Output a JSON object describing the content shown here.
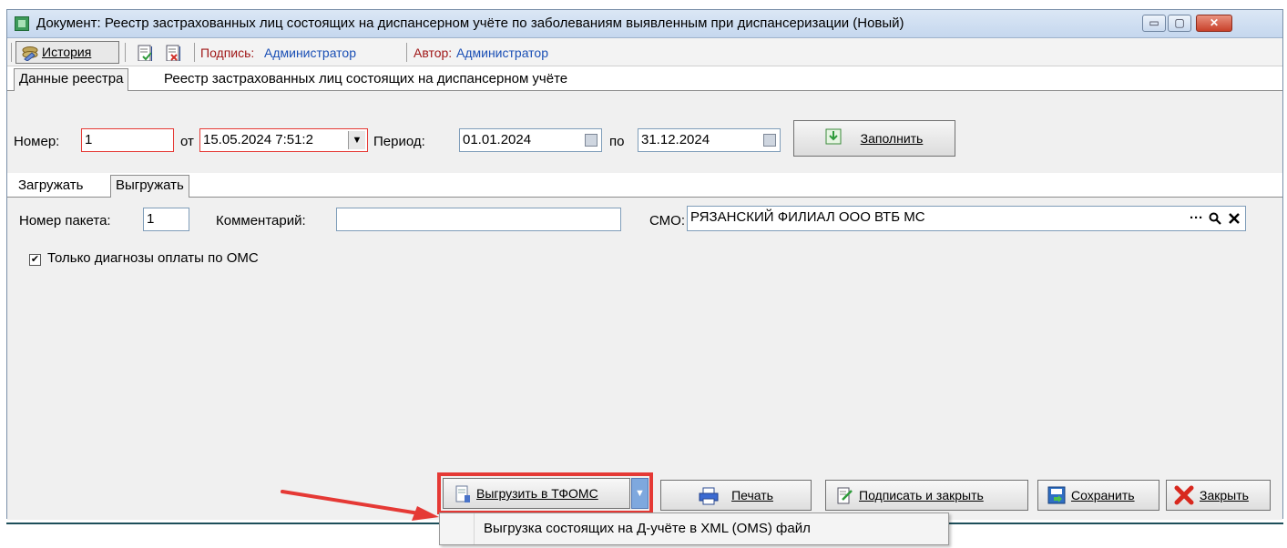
{
  "window": {
    "title": "Документ: Реестр застрахованных лиц состоящих на диспансерном учёте по заболеваниям выявленным при диспансеризации (Новый)",
    "controls": {
      "minimize": "▭",
      "maximize": "▢",
      "close": "✕"
    }
  },
  "toolbar": {
    "history_prefix": "",
    "history_label": "История",
    "sign_label": "Подпись:",
    "sign_value": "Администратор",
    "author_label": "Автор:",
    "author_value": "Администратор"
  },
  "tabs": [
    {
      "label": "Данные реестра",
      "active": true
    },
    {
      "label": "Реестр застрахованных лиц состоящих на диспансерном учёте",
      "active": false
    }
  ],
  "header_fields": {
    "number_label": "Номер:",
    "number_value": "1",
    "from_label": "от",
    "from_value": "15.05.2024 7:51:2",
    "period_label": "Период:",
    "period_start": "01.01.2024",
    "to_label": "по",
    "period_end": "31.12.2024",
    "fill_button": "Заполнить"
  },
  "subtabs": [
    {
      "label": "Загружать",
      "active": false
    },
    {
      "label": "Выгружать",
      "active": true
    }
  ],
  "export_panel": {
    "package_label": "Номер пакета:",
    "package_value": "1",
    "comment_label": "Комментарий:",
    "comment_value": "",
    "smo_label": "СМО:",
    "smo_value": "РЯЗАНСКИЙ ФИЛИАЛ ООО ВТБ МС",
    "smo_more": "···",
    "only_oms_label": "Только диагнозы оплаты по ОМС",
    "only_oms_checked": true
  },
  "bottom_buttons": {
    "export_tfoms": "Выгрузить в ТФОМС",
    "print": "Печать",
    "sign_close": "Подписать и закрыть",
    "save": "Сохранить",
    "close": "Закрыть"
  },
  "dropdown_menu": {
    "items": [
      "Выгрузка состоящих на Д-учёте в XML (OMS) файл"
    ]
  },
  "colors": {
    "highlight": "#e53935",
    "arrow": "#e53935",
    "link_blue": "#1a4fb5",
    "sign_red": "#a01818"
  }
}
